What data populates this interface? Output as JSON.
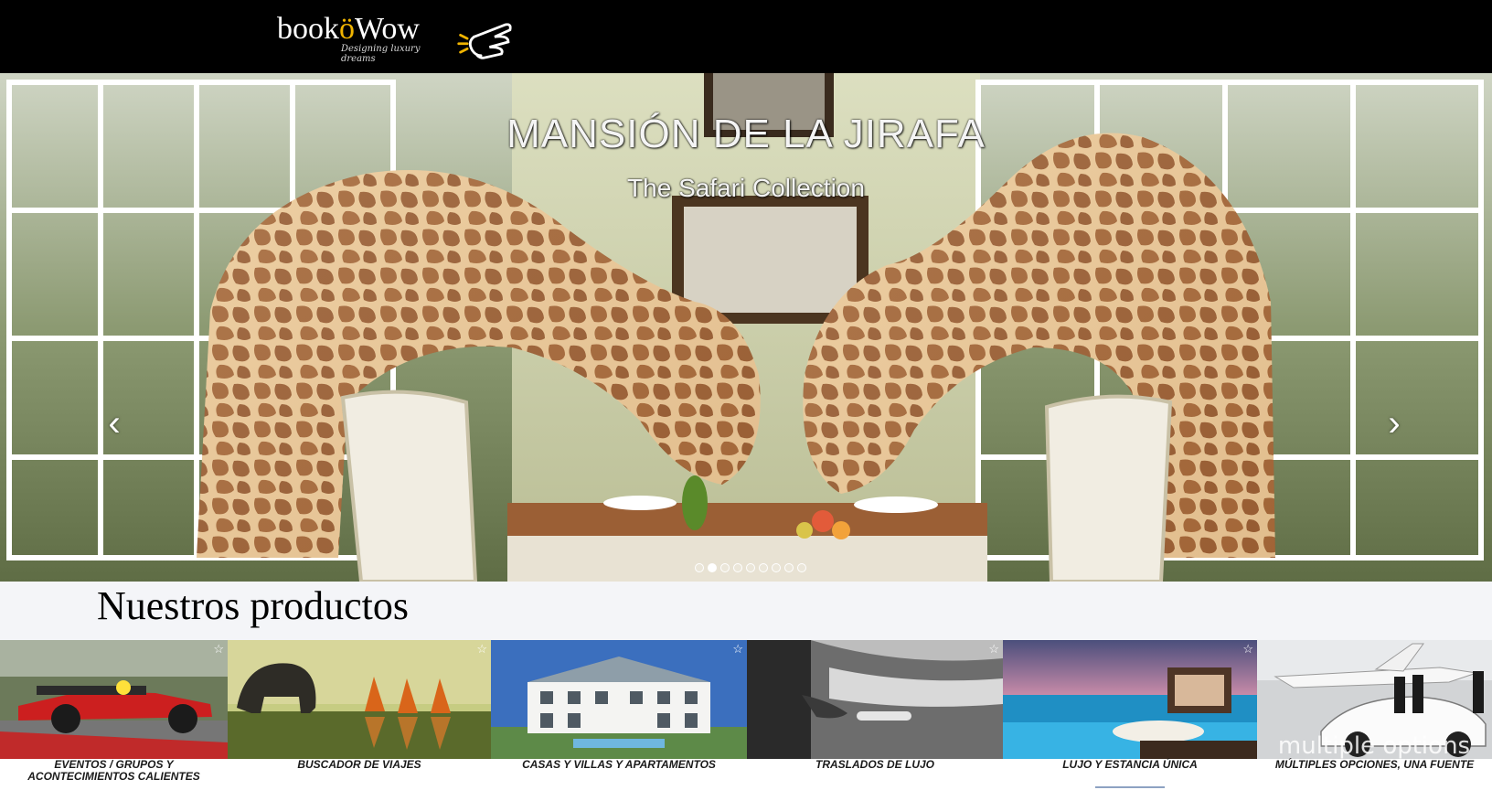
{
  "header": {
    "logo_main": "book",
    "logo_accent": "ö",
    "logo_end": "Wow",
    "logo_tagline": "Designing luxury dreams"
  },
  "hero": {
    "title": "MANSIÓN DE LA JIRAFA",
    "subtitle": "The Safari Collection",
    "prev_icon": "‹",
    "next_icon": "›",
    "slide_count": 9,
    "active_slide": 1
  },
  "products": {
    "heading": "Nuestros productos",
    "items": [
      {
        "label": "EVENTOS / GRUPOS Y ACONTECIMIENTOS CALIENTES",
        "icon": "race-car-image"
      },
      {
        "label": "BUSCADOR DE VIAJES",
        "icon": "elephant-monks-image"
      },
      {
        "label": "CASAS Y VILLAS Y APARTAMENTOS",
        "icon": "villa-image"
      },
      {
        "label": "TRASLADOS DE LUJO",
        "icon": "car-door-image"
      },
      {
        "label": "LUJO Y ESTANCIA ÚNICA",
        "icon": "overwater-bungalow-image"
      },
      {
        "label": "MÚLTIPLES OPCIONES, UNA FUENTE",
        "icon": "jet-car-image",
        "overlay": "multiple options"
      }
    ],
    "favorite_icon": "☆"
  }
}
